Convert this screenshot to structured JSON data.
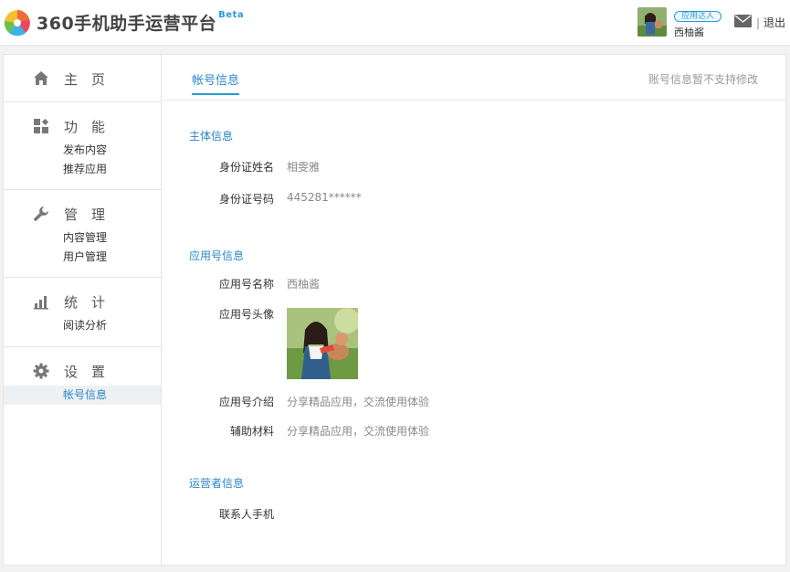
{
  "header": {
    "brand": "360手机助手运营平台",
    "beta": "Beta",
    "user_badge": "应用达人",
    "user_name": "西柚酱",
    "logout_sep": "|",
    "logout": "退出"
  },
  "sidebar": {
    "groups": [
      {
        "icon": "home-icon",
        "label": "主页",
        "items": []
      },
      {
        "icon": "grid-icon",
        "label": "功能",
        "items": [
          "发布内容",
          "推荐应用"
        ]
      },
      {
        "icon": "wrench-icon",
        "label": "管理",
        "items": [
          "内容管理",
          "用户管理"
        ]
      },
      {
        "icon": "bar-chart-icon",
        "label": "统计",
        "items": [
          "阅读分析"
        ]
      },
      {
        "icon": "gear-icon",
        "label": "设置",
        "items": [
          "帐号信息"
        ]
      }
    ],
    "active_item": "帐号信息"
  },
  "tabs": {
    "active": "帐号信息",
    "note": "账号信息暂不支持修改"
  },
  "sections": {
    "subject": {
      "title": "主体信息",
      "id_name_label": "身份证姓名",
      "id_name_value": "相雯雅",
      "id_number_label": "身份证号码",
      "id_number_value": "445281******"
    },
    "app": {
      "title": "应用号信息",
      "name_label": "应用号名称",
      "name_value": "西柚酱",
      "avatar_label": "应用号头像",
      "intro_label": "应用号介绍",
      "intro_value": "分享精品应用，交流使用体验",
      "material_label": "辅助材料",
      "material_value": "分享精品应用，交流使用体验"
    },
    "operator": {
      "title": "运营者信息",
      "phone_label": "联系人手机",
      "phone_value": ""
    }
  },
  "colors": {
    "accent": "#2a9bd6",
    "link": "#2a85c8",
    "active_bg": "#edf1f4"
  }
}
